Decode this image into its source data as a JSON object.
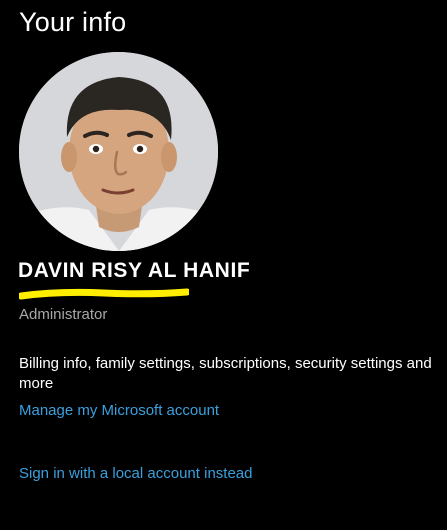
{
  "page": {
    "title": "Your info"
  },
  "account": {
    "name": "DAVIN RISY AL HANIF",
    "role": "Administrator",
    "billing_info": "Billing info, family settings, subscriptions, security settings and more",
    "manage_link": "Manage my Microsoft account",
    "local_account_link": "Sign in with a local account instead"
  },
  "colors": {
    "background": "#000000",
    "text": "#ffffff",
    "secondary_text": "#a8a8a8",
    "link": "#3aa0dd",
    "highlight": "#ffee00"
  }
}
